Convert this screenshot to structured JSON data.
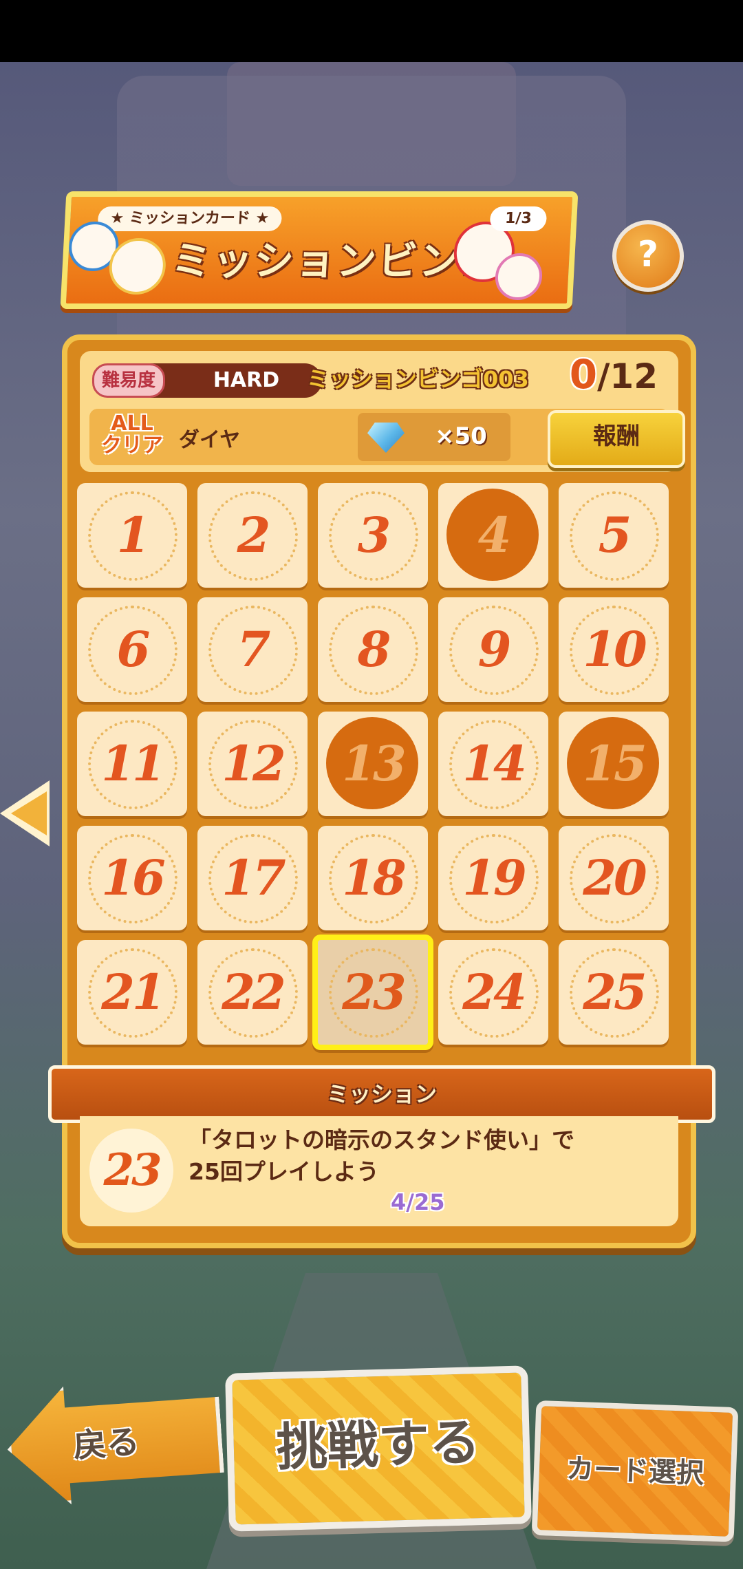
{
  "banner": {
    "subtitle": "★ ミッションカード ★",
    "title": "ミッションビンゴ",
    "page": "1/3"
  },
  "help_label": "?",
  "card_info": {
    "difficulty_label": "難易度",
    "difficulty_value": "HARD",
    "bingo_name": "ミッションビンゴ003",
    "progress_current": "0",
    "progress_total": "/12",
    "allclear_label": "ALL\nクリア",
    "reward_name": "ダイヤ",
    "reward_qty": "×50",
    "reward_button": "報酬"
  },
  "grid": {
    "numbers": [
      "1",
      "2",
      "3",
      "4",
      "5",
      "6",
      "7",
      "8",
      "9",
      "10",
      "11",
      "12",
      "13",
      "14",
      "15",
      "16",
      "17",
      "18",
      "19",
      "20",
      "21",
      "22",
      "23",
      "24",
      "25"
    ],
    "completed": [
      "4",
      "13",
      "15"
    ],
    "selected": "23"
  },
  "mission": {
    "header": "ミッション",
    "number": "23",
    "text": "「タロットの暗示のスタンド使い」で\n25回プレイしよう",
    "progress": "4/25"
  },
  "buttons": {
    "back": "戻る",
    "challenge": "挑戦する",
    "card_select": "カード選択"
  },
  "colors": {
    "accent": "#e2571b",
    "card_bg": "#d8881d",
    "highlight": "#ffef18"
  }
}
